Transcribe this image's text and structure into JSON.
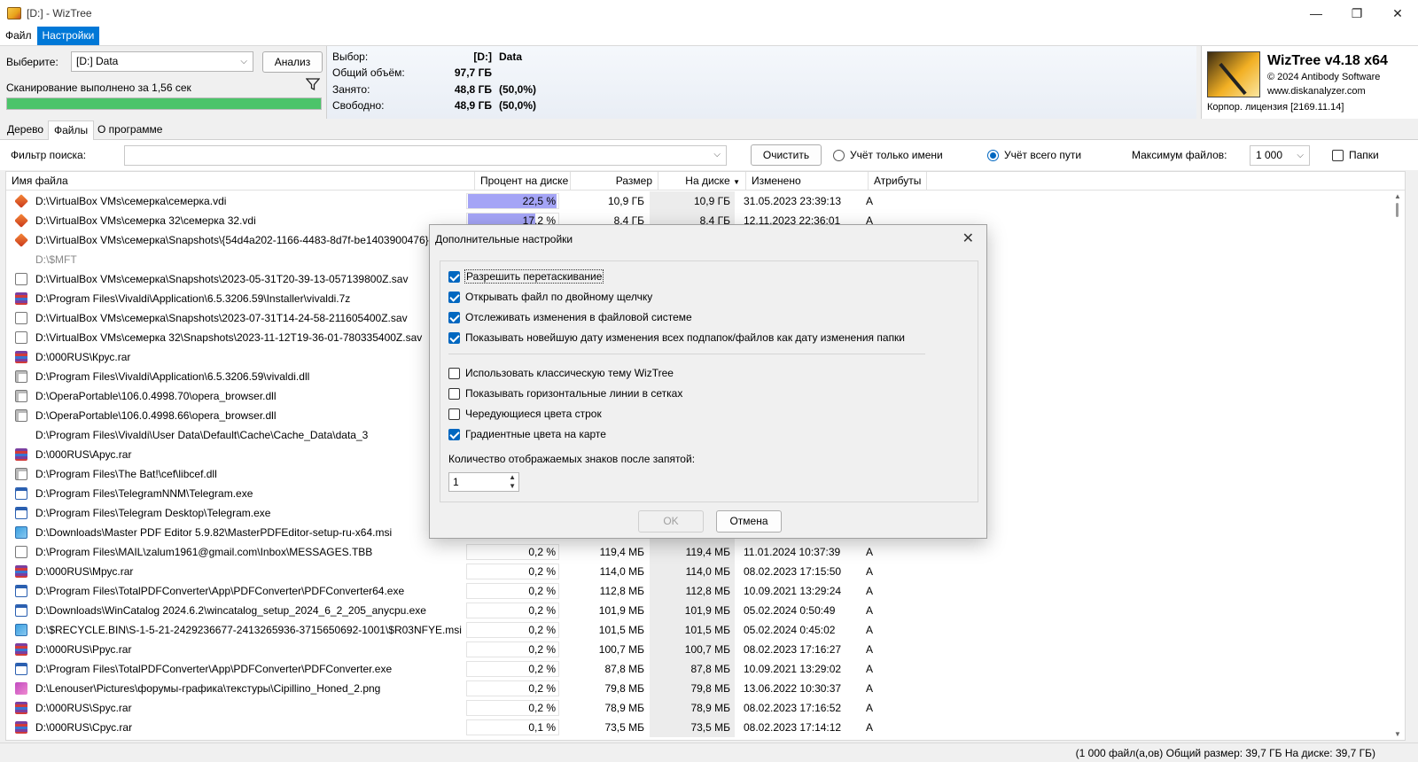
{
  "window": {
    "title": "[D:]  - WizTree",
    "minimize": "—",
    "maximize": "❐",
    "close": "✕"
  },
  "menu": [
    "Файл",
    "Настройки"
  ],
  "top": {
    "select_label": "Выберите:",
    "drive_value": "[D:] Data",
    "analyze_label": "Анализ",
    "scan_status": "Сканирование выполнено за 1,56 сек",
    "progress": 1.0,
    "info": [
      {
        "key": "Выбор:",
        "val": "[D:]",
        "extra": "Data"
      },
      {
        "key": "Общий объём:",
        "val": "97,7 ГБ",
        "extra": ""
      },
      {
        "key": "Занято:",
        "val": "48,8 ГБ",
        "extra": "(50,0%)"
      },
      {
        "key": "Свободно:",
        "val": "48,9 ГБ",
        "extra": "(50,0%)"
      }
    ]
  },
  "brand": {
    "title": "WizTree v4.18 x64",
    "copyright": "© 2024 Antibody Software",
    "site": "www.diskanalyzer.com",
    "license": "Корпор. лицензия [2169.11.14]"
  },
  "tabs": [
    "Дерево",
    "Файлы",
    "О программе"
  ],
  "filter": {
    "label": "Фильтр поиска:",
    "value": "",
    "clear_label": "Очистить",
    "radio_name_only": "Учёт только имени",
    "radio_full_path": "Учёт всего пути",
    "max_files_label": "Максимум файлов:",
    "max_files_value": "1 000",
    "folders_label": "Папки"
  },
  "columns": {
    "name": "Имя файла",
    "pct": "Процент на диске",
    "size": "Размер",
    "disk": "На диске",
    "modified": "Изменено",
    "attrs": "Атрибуты"
  },
  "rows": [
    {
      "icon": "vbox",
      "name": "D:\\VirtualBox VMs\\семерка\\семерка.vdi",
      "pct_value": 22.5,
      "pct": "22,5 %",
      "size": "10,9 ГБ",
      "disk": "10,9 ГБ",
      "modified": "31.05.2023 23:39:13",
      "attr": "A"
    },
    {
      "icon": "vbox",
      "name": "D:\\VirtualBox VMs\\семерка 32\\семерка 32.vdi",
      "pct_value": 17.2,
      "pct": "17,2 %",
      "size": "8,4 ГБ",
      "disk": "8,4 ГБ",
      "modified": "12.11.2023 22:36:01",
      "attr": "A"
    },
    {
      "icon": "vbox",
      "name": "D:\\VirtualBox VMs\\семерка\\Snapshots\\{54d4a202-1166-4483-8d7f-be1403900476}.vdi",
      "pct_value": null,
      "pct": "",
      "size": "",
      "disk": "",
      "modified": "",
      "attr": ""
    },
    {
      "icon": "none",
      "gray": true,
      "name": "D:\\$MFT",
      "pct_value": null,
      "pct": "",
      "size": "",
      "disk": "",
      "modified": "",
      "attr": ""
    },
    {
      "icon": "file",
      "name": "D:\\VirtualBox VMs\\семерка\\Snapshots\\2023-05-31T20-39-13-057139800Z.sav",
      "pct_value": null,
      "pct": "",
      "size": "",
      "disk": "",
      "modified": "",
      "attr": ""
    },
    {
      "icon": "rar",
      "name": "D:\\Program Files\\Vivaldi\\Application\\6.5.3206.59\\Installer\\vivaldi.7z",
      "pct_value": null,
      "pct": "",
      "size": "",
      "disk": "",
      "modified": "",
      "attr": ""
    },
    {
      "icon": "file",
      "name": "D:\\VirtualBox VMs\\семерка\\Snapshots\\2023-07-31T14-24-58-211605400Z.sav",
      "pct_value": null,
      "pct": "",
      "size": "",
      "disk": "",
      "modified": "",
      "attr": ""
    },
    {
      "icon": "file",
      "name": "D:\\VirtualBox VMs\\семерка 32\\Snapshots\\2023-11-12T19-36-01-780335400Z.sav",
      "pct_value": null,
      "pct": "",
      "size": "",
      "disk": "",
      "modified": "",
      "attr": ""
    },
    {
      "icon": "rar",
      "name": "D:\\000RUS\\Крус.rar",
      "pct_value": null,
      "pct": "",
      "size": "",
      "disk": "",
      "modified": "",
      "attr": ""
    },
    {
      "icon": "dll",
      "name": "D:\\Program Files\\Vivaldi\\Application\\6.5.3206.59\\vivaldi.dll",
      "pct_value": null,
      "pct": "",
      "size": "",
      "disk": "",
      "modified": "",
      "attr": ""
    },
    {
      "icon": "dll",
      "name": "D:\\OperaPortable\\106.0.4998.70\\opera_browser.dll",
      "pct_value": null,
      "pct": "",
      "size": "",
      "disk": "",
      "modified": "",
      "attr": ""
    },
    {
      "icon": "dll",
      "name": "D:\\OperaPortable\\106.0.4998.66\\opera_browser.dll",
      "pct_value": null,
      "pct": "",
      "size": "",
      "disk": "",
      "modified": "",
      "attr": ""
    },
    {
      "icon": "none",
      "name": "D:\\Program Files\\Vivaldi\\User Data\\Default\\Cache\\Cache_Data\\data_3",
      "pct_value": null,
      "pct": "",
      "size": "",
      "disk": "",
      "modified": "",
      "attr": ""
    },
    {
      "icon": "rar",
      "name": "D:\\000RUS\\Арус.rar",
      "pct_value": null,
      "pct": "",
      "size": "",
      "disk": "",
      "modified": "",
      "attr": ""
    },
    {
      "icon": "dll",
      "name": "D:\\Program Files\\The Bat!\\cef\\libcef.dll",
      "pct_value": null,
      "pct": "",
      "size": "",
      "disk": "",
      "modified": "",
      "attr": ""
    },
    {
      "icon": "exe",
      "name": "D:\\Program Files\\TelegramNNM\\Telegram.exe",
      "pct_value": null,
      "pct": "",
      "size": "",
      "disk": "",
      "modified": "",
      "attr": ""
    },
    {
      "icon": "exe",
      "name": "D:\\Program Files\\Telegram Desktop\\Telegram.exe",
      "pct_value": null,
      "pct": "",
      "size": "",
      "disk": "",
      "modified": "",
      "attr": ""
    },
    {
      "icon": "msi",
      "name": "D:\\Downloads\\Master PDF Editor 5.9.82\\MasterPDFEditor-setup-ru-x64.msi",
      "pct_value": null,
      "pct": "",
      "size": "",
      "disk": "",
      "modified": "",
      "attr": ""
    },
    {
      "icon": "file",
      "name": "D:\\Program Files\\MAIL\\zalum1961@gmail.com\\Inbox\\MESSAGES.TBB",
      "pct_value": 0.2,
      "pct": "0,2 %",
      "size": "119,4 МБ",
      "disk": "119,4 МБ",
      "modified": "11.01.2024 10:37:39",
      "attr": "A"
    },
    {
      "icon": "rar",
      "name": "D:\\000RUS\\Мрус.rar",
      "pct_value": 0.2,
      "pct": "0,2 %",
      "size": "114,0 МБ",
      "disk": "114,0 МБ",
      "modified": "08.02.2023 17:15:50",
      "attr": "A"
    },
    {
      "icon": "exe",
      "name": "D:\\Program Files\\TotalPDFConverter\\App\\PDFConverter\\PDFConverter64.exe",
      "pct_value": 0.2,
      "pct": "0,2 %",
      "size": "112,8 МБ",
      "disk": "112,8 МБ",
      "modified": "10.09.2021 13:29:24",
      "attr": "A"
    },
    {
      "icon": "exe",
      "name": "D:\\Downloads\\WinCatalog 2024.6.2\\wincatalog_setup_2024_6_2_205_anycpu.exe",
      "pct_value": 0.2,
      "pct": "0,2 %",
      "size": "101,9 МБ",
      "disk": "101,9 МБ",
      "modified": "05.02.2024 0:50:49",
      "attr": "A"
    },
    {
      "icon": "msi",
      "name": "D:\\$RECYCLE.BIN\\S-1-5-21-2429236677-2413265936-3715650692-1001\\$R03NFYE.msi",
      "pct_value": 0.2,
      "pct": "0,2 %",
      "size": "101,5 МБ",
      "disk": "101,5 МБ",
      "modified": "05.02.2024 0:45:02",
      "attr": "A"
    },
    {
      "icon": "rar",
      "name": "D:\\000RUS\\Ррус.rar",
      "pct_value": 0.2,
      "pct": "0,2 %",
      "size": "100,7 МБ",
      "disk": "100,7 МБ",
      "modified": "08.02.2023 17:16:27",
      "attr": "A"
    },
    {
      "icon": "exe",
      "name": "D:\\Program Files\\TotalPDFConverter\\App\\PDFConverter\\PDFConverter.exe",
      "pct_value": 0.2,
      "pct": "0,2 %",
      "size": "87,8 МБ",
      "disk": "87,8 МБ",
      "modified": "10.09.2021 13:29:02",
      "attr": "A"
    },
    {
      "icon": "png",
      "name": "D:\\Lenouser\\Pictures\\форумы-графика\\текстуры\\Cipillino_Honed_2.png",
      "pct_value": 0.2,
      "pct": "0,2 %",
      "size": "79,8 МБ",
      "disk": "79,8 МБ",
      "modified": "13.06.2022 10:30:37",
      "attr": "A"
    },
    {
      "icon": "rar",
      "name": "D:\\000RUS\\Spус.rar",
      "pct_value": 0.2,
      "pct": "0,2 %",
      "size": "78,9 МБ",
      "disk": "78,9 МБ",
      "modified": "08.02.2023 17:16:52",
      "attr": "A"
    },
    {
      "icon": "rar",
      "name": "D:\\000RUS\\Срус.rar",
      "pct_value": 0.1,
      "pct": "0,1 %",
      "size": "73,5 МБ",
      "disk": "73,5 МБ",
      "modified": "08.02.2023 17:14:12",
      "attr": "A"
    }
  ],
  "status": "(1 000 файл(а,ов)  Общий размер: 39,7 ГБ  На диске: 39,7 ГБ)",
  "dialog": {
    "title": "Дополнительные настройки",
    "close": "✕",
    "options": [
      {
        "label": "Разрешить перетаскивание",
        "checked": true
      },
      {
        "label": "Открывать файл по двойному щелчку",
        "checked": true
      },
      {
        "label": "Отслеживать изменения в файловой системе",
        "checked": true
      },
      {
        "label": "Показывать новейшую дату изменения всех подпапок/файлов как дату изменения папки",
        "checked": true
      },
      {
        "label": "Использовать классическую тему WizTree",
        "checked": false
      },
      {
        "label": "Показывать горизонтальные линии в сетках",
        "checked": false
      },
      {
        "label": "Чередующиеся цвета строк",
        "checked": false
      },
      {
        "label": "Градиентные цвета на карте",
        "checked": true
      }
    ],
    "decimals_label": "Количество отображаемых знаков после запятой:",
    "decimals_value": "1",
    "ok_label": "OK",
    "cancel_label": "Отмена"
  }
}
